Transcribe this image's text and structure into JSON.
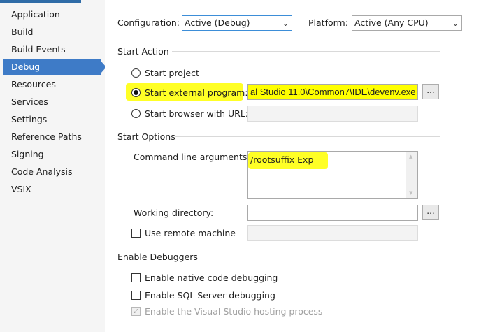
{
  "sidebar": {
    "items": [
      {
        "label": "Application"
      },
      {
        "label": "Build"
      },
      {
        "label": "Build Events"
      },
      {
        "label": "Debug"
      },
      {
        "label": "Resources"
      },
      {
        "label": "Services"
      },
      {
        "label": "Settings"
      },
      {
        "label": "Reference Paths"
      },
      {
        "label": "Signing"
      },
      {
        "label": "Code Analysis"
      },
      {
        "label": "VSIX"
      }
    ],
    "active": "Debug"
  },
  "header": {
    "configuration_label": "Configuration:",
    "configuration_value": "Active (Debug)",
    "platform_label": "Platform:",
    "platform_value": "Active (Any CPU)"
  },
  "start_action": {
    "title": "Start Action",
    "start_project": "Start project",
    "start_external": "Start external program:",
    "external_path": "al Studio 11.0\\Common7\\IDE\\devenv.exe",
    "browse_label": "...",
    "start_browser": "Start browser with URL:",
    "browser_url": ""
  },
  "start_options": {
    "title": "Start Options",
    "cmd_label": "Command line arguments:",
    "cmd_value": "/rootsuffix Exp",
    "workdir_label": "Working directory:",
    "workdir_value": "",
    "browse_label": "...",
    "remote_label": "Use remote machine",
    "remote_value": ""
  },
  "debuggers": {
    "title": "Enable Debuggers",
    "native": "Enable native code debugging",
    "sql": "Enable SQL Server debugging",
    "hosting": "Enable the Visual Studio hosting process"
  },
  "colors": {
    "accent": "#3e7bc7",
    "highlight": "#ffff00"
  }
}
